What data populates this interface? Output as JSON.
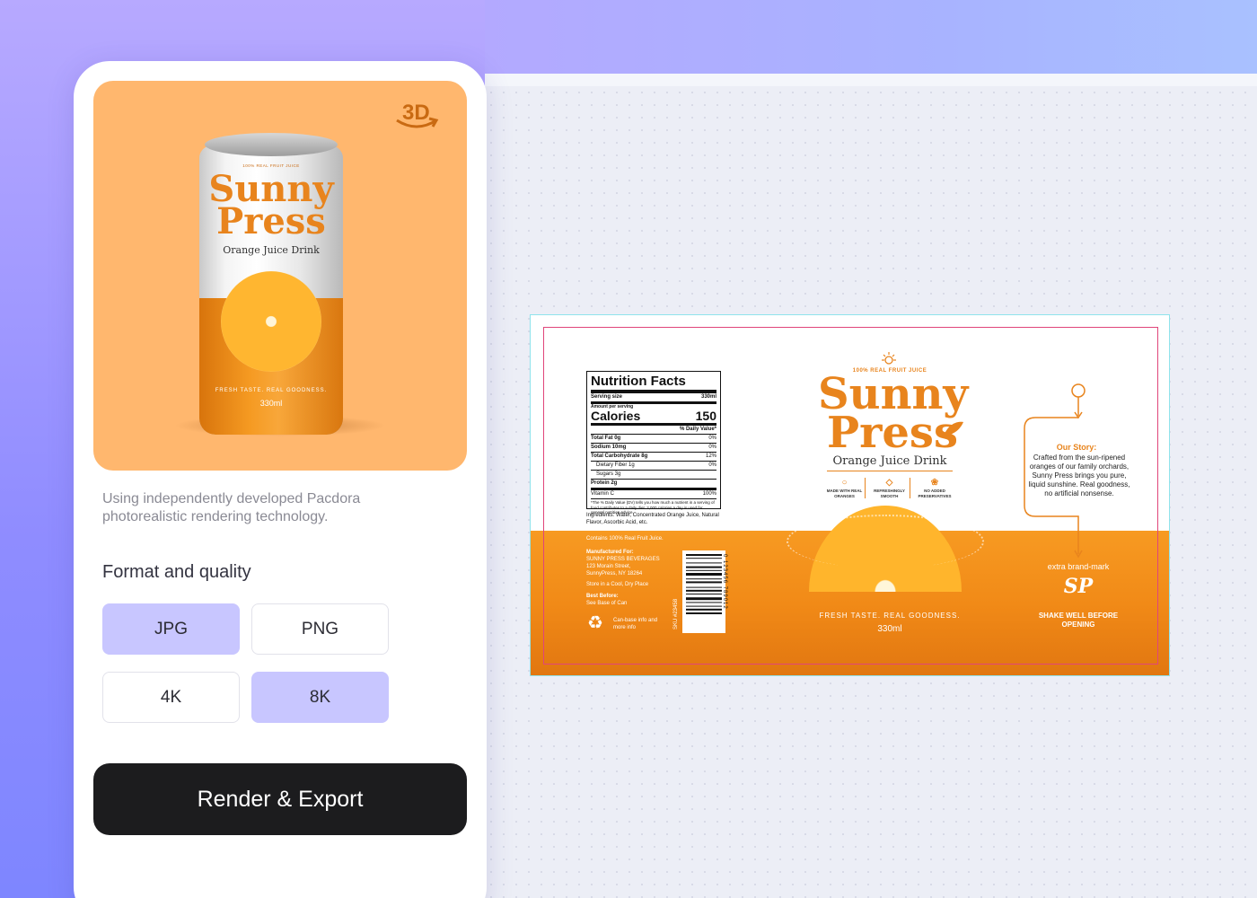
{
  "preview": {
    "badge_3d": "3D",
    "can": {
      "tagline": "100% REAL FRUIT JUICE",
      "brand_line1": "Sunny",
      "brand_line2": "Press",
      "product": "Orange Juice Drink",
      "features": [
        "MADE WITH REAL ORANGES",
        "REFRESHINGLY SMOOTH",
        "NO ADDED PRESERVATIVES"
      ],
      "slogan": "FRESH TASTE.  REAL GOODNESS.",
      "volume": "330ml"
    }
  },
  "description": "Using independently developed Pacdora photorealistic rendering technology.",
  "format_section": {
    "title": "Format and quality",
    "formats": [
      {
        "label": "JPG",
        "selected": true
      },
      {
        "label": "PNG",
        "selected": false
      }
    ],
    "qualities": [
      {
        "label": "4K",
        "selected": false
      },
      {
        "label": "8K",
        "selected": true
      }
    ]
  },
  "export_button": "Render & Export",
  "dieline": {
    "nutrition": {
      "title": "Nutrition Facts",
      "serving_label": "Serving size",
      "serving_value": "330ml",
      "amount_label": "Amount per serving",
      "calories_label": "Calories",
      "calories_value": "150",
      "dv_header": "% Daily Value*",
      "rows": [
        {
          "label": "Total Fat 0g",
          "value": "0%"
        },
        {
          "label": "Sodium 10mg",
          "value": "0%"
        },
        {
          "label": "Total Carbohydrate 8g",
          "value": "12%"
        },
        {
          "label": "Dietary Fiber 1g",
          "value": "0%"
        },
        {
          "label": "Sugars 3g",
          "value": ""
        },
        {
          "label": "Protein 2g",
          "value": ""
        },
        {
          "label": "Vitamin C",
          "value": "100%"
        }
      ],
      "footnote": "*The % Daily Value (DV) tells you how much a nutrient in a serving of food contributes to a daily diet. 2,000 calories a day is used for general nutrition advice."
    },
    "ingredients": "Ingredients: Water, Concentrated Orange Juice, Natural Flavor, Ascorbic Acid, etc.",
    "contains": "Contains 100% Real Fruit Juice.",
    "manufactured_label": "Manufactured For:",
    "manufactured_lines": [
      "SUNNY PRESS BEVERAGES",
      "123 Morain Street,",
      "SunnyPress, NY 18264"
    ],
    "storage": "Store in a Cool, Dry Place",
    "best_before_label": "Best Before:",
    "best_before_value": "See Base of Can",
    "recycle": "Can-base info and more info",
    "sku": "SKU #23458",
    "barcode_number": "0 123456 789012",
    "tagline": "100% REAL FRUIT JUICE",
    "brand_line1": "Sunny",
    "brand_line2": "Press",
    "product": "Orange Juice Drink",
    "features": [
      "MADE WITH REAL ORANGES",
      "REFRESHINGLY SMOOTH",
      "NO ADDED PRESERVATIVES"
    ],
    "slogan": "FRESH TASTE.  REAL GOODNESS.",
    "volume": "330ml",
    "story_title": "Our Story:",
    "story_text": "Crafted from the sun-ripened oranges of our family orchards, Sunny Press brings you pure, liquid sunshine. Real goodness, no artificial nonsense.",
    "extra_brand": "extra brand-mark",
    "monogram": "SP",
    "shake": "SHAKE WELL BEFORE OPENING"
  },
  "colors": {
    "accent": "#c8c6ff",
    "orange": "#f18a17",
    "brand_text": "#e8841d",
    "button": "#1c1c1e"
  }
}
